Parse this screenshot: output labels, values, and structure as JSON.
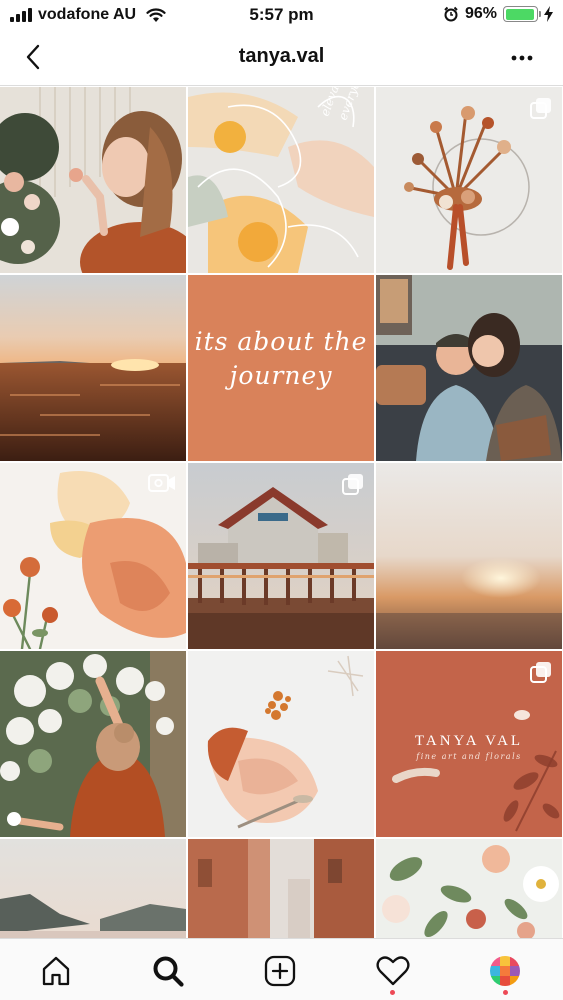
{
  "status_bar": {
    "carrier": "vodafone AU",
    "time": "5:57 pm",
    "battery": "96%",
    "battery_level": 0.96,
    "battery_color": "#4cd964"
  },
  "header": {
    "title": "tanya.val",
    "back_icon": "chevron-left-icon",
    "more_icon": "more-horizontal-icon"
  },
  "grid": {
    "posts": [
      {
        "kind": "photo",
        "subject": "woman smelling flowers"
      },
      {
        "kind": "photo",
        "subject": "abstract paint with handwriting"
      },
      {
        "kind": "carousel",
        "subject": "dried floral hoop"
      },
      {
        "kind": "photo",
        "subject": "sunset over water"
      },
      {
        "kind": "photo",
        "subject": "its about the journey",
        "overlay_text": "its about the journey"
      },
      {
        "kind": "photo",
        "subject": "couple on sofa"
      },
      {
        "kind": "video",
        "subject": "peach paint and dried flowers"
      },
      {
        "kind": "carousel",
        "subject": "pier house at sunset"
      },
      {
        "kind": "photo",
        "subject": "blurred sunset"
      },
      {
        "kind": "photo",
        "subject": "woman with white flowers"
      },
      {
        "kind": "photo",
        "subject": "paint smear with brush"
      },
      {
        "kind": "carousel",
        "subject": "TANYA VAL logo tile",
        "overlay_text": "TANYA VAL",
        "overlay_subtext": "fine art and florals"
      },
      {
        "kind": "photo",
        "subject": "mountains at dusk"
      },
      {
        "kind": "photo",
        "subject": "narrow street"
      },
      {
        "kind": "photo",
        "subject": "flowers with green leaves"
      }
    ]
  },
  "tab_bar": {
    "items": [
      {
        "name": "home",
        "icon": "home-icon"
      },
      {
        "name": "search",
        "icon": "search-icon",
        "active": true
      },
      {
        "name": "new-post",
        "icon": "plus-square-icon"
      },
      {
        "name": "activity",
        "icon": "heart-icon",
        "notification": true
      },
      {
        "name": "profile",
        "icon": "avatar-icon",
        "notification": true
      }
    ]
  }
}
